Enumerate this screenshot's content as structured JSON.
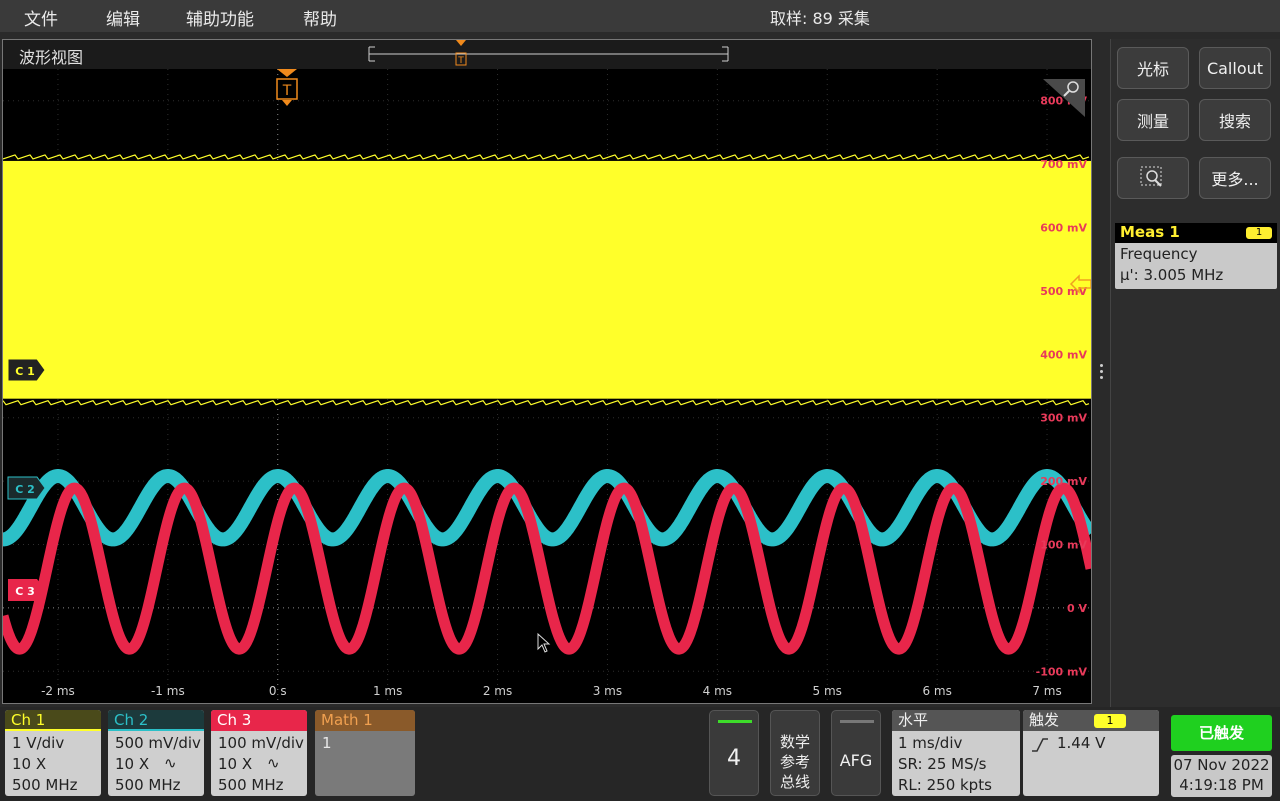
{
  "menu": {
    "file": "文件",
    "edit": "编辑",
    "utility": "辅助功能",
    "help": "帮助"
  },
  "acquisition": {
    "text": "取样: 89 采集"
  },
  "waveform_view": {
    "title": "波形视图",
    "y_labels": [
      "800 mV",
      "700 mV",
      "600 mV",
      "500 mV",
      "400 mV",
      "300 mV",
      "200 mV",
      "100 mV",
      "0 V",
      "-100 mV"
    ],
    "x_labels": [
      "-2 ms",
      "-1 ms",
      "0 s",
      "1 ms",
      "2 ms",
      "3 ms",
      "4 ms",
      "5 ms",
      "6 ms",
      "7 ms"
    ],
    "trigger_marker": "T",
    "channel_markers": {
      "c1": "C 1",
      "c2": "C 2",
      "c3": "C 3"
    },
    "colors": {
      "ch1": "#ffff2a",
      "ch2": "#2cc0c8",
      "ch3": "#e8264a",
      "label": "#e83a5a",
      "trigger": "#f08a1c"
    }
  },
  "chart_data": {
    "type": "line",
    "xlabel": "",
    "ylabel": "",
    "x_unit": "ms",
    "xlim": [
      -2.5,
      7.4
    ],
    "ylim": [
      -150,
      850
    ],
    "series": [
      {
        "name": "Ch 1",
        "kind": "band",
        "y_min": 330,
        "y_max": 705
      },
      {
        "name": "Ch 2",
        "kind": "sine",
        "center": 158,
        "amplitude": 50,
        "period_ms": 1.0,
        "phase_ms": 0.0
      },
      {
        "name": "Ch 3",
        "kind": "sine",
        "center": 62,
        "amplitude": 127,
        "period_ms": 1.0,
        "phase_ms": 0.15
      }
    ]
  },
  "right_panel": {
    "cursors": "光标",
    "callout": "Callout",
    "measure": "测量",
    "search": "搜索",
    "more": "更多...",
    "meas_card": {
      "title": "Meas 1",
      "badge": "1",
      "name": "Frequency",
      "value": "μ': 3.005 MHz"
    }
  },
  "channels": [
    {
      "label": "Ch 1",
      "scale": "1 V/div",
      "probe": "10 X",
      "bw": "500 MHz",
      "color": "#ffff2a"
    },
    {
      "label": "Ch 2",
      "scale": "500 mV/div",
      "probe": "10 X",
      "bw": "500 MHz",
      "color": "#2cc0c8"
    },
    {
      "label": "Ch 3",
      "scale": "100 mV/div",
      "probe": "10 X",
      "bw": "500 MHz",
      "color": "#e8264a"
    }
  ],
  "math": {
    "label": "Math 1",
    "value": "1"
  },
  "bottom": {
    "add_channel": "4",
    "math_ref_bus": [
      "数学",
      "参考",
      "总线"
    ],
    "afg": "AFG",
    "horizontal": {
      "title": "水平",
      "scale": "1 ms/div",
      "sr": "SR: 25 MS/s",
      "rl": "RL: 250 kpts"
    },
    "trigger": {
      "title": "触发",
      "badge": "1",
      "level": "1.44 V"
    },
    "triggered": "已触发",
    "date": "07 Nov 2022",
    "time": "4:19:18 PM"
  }
}
